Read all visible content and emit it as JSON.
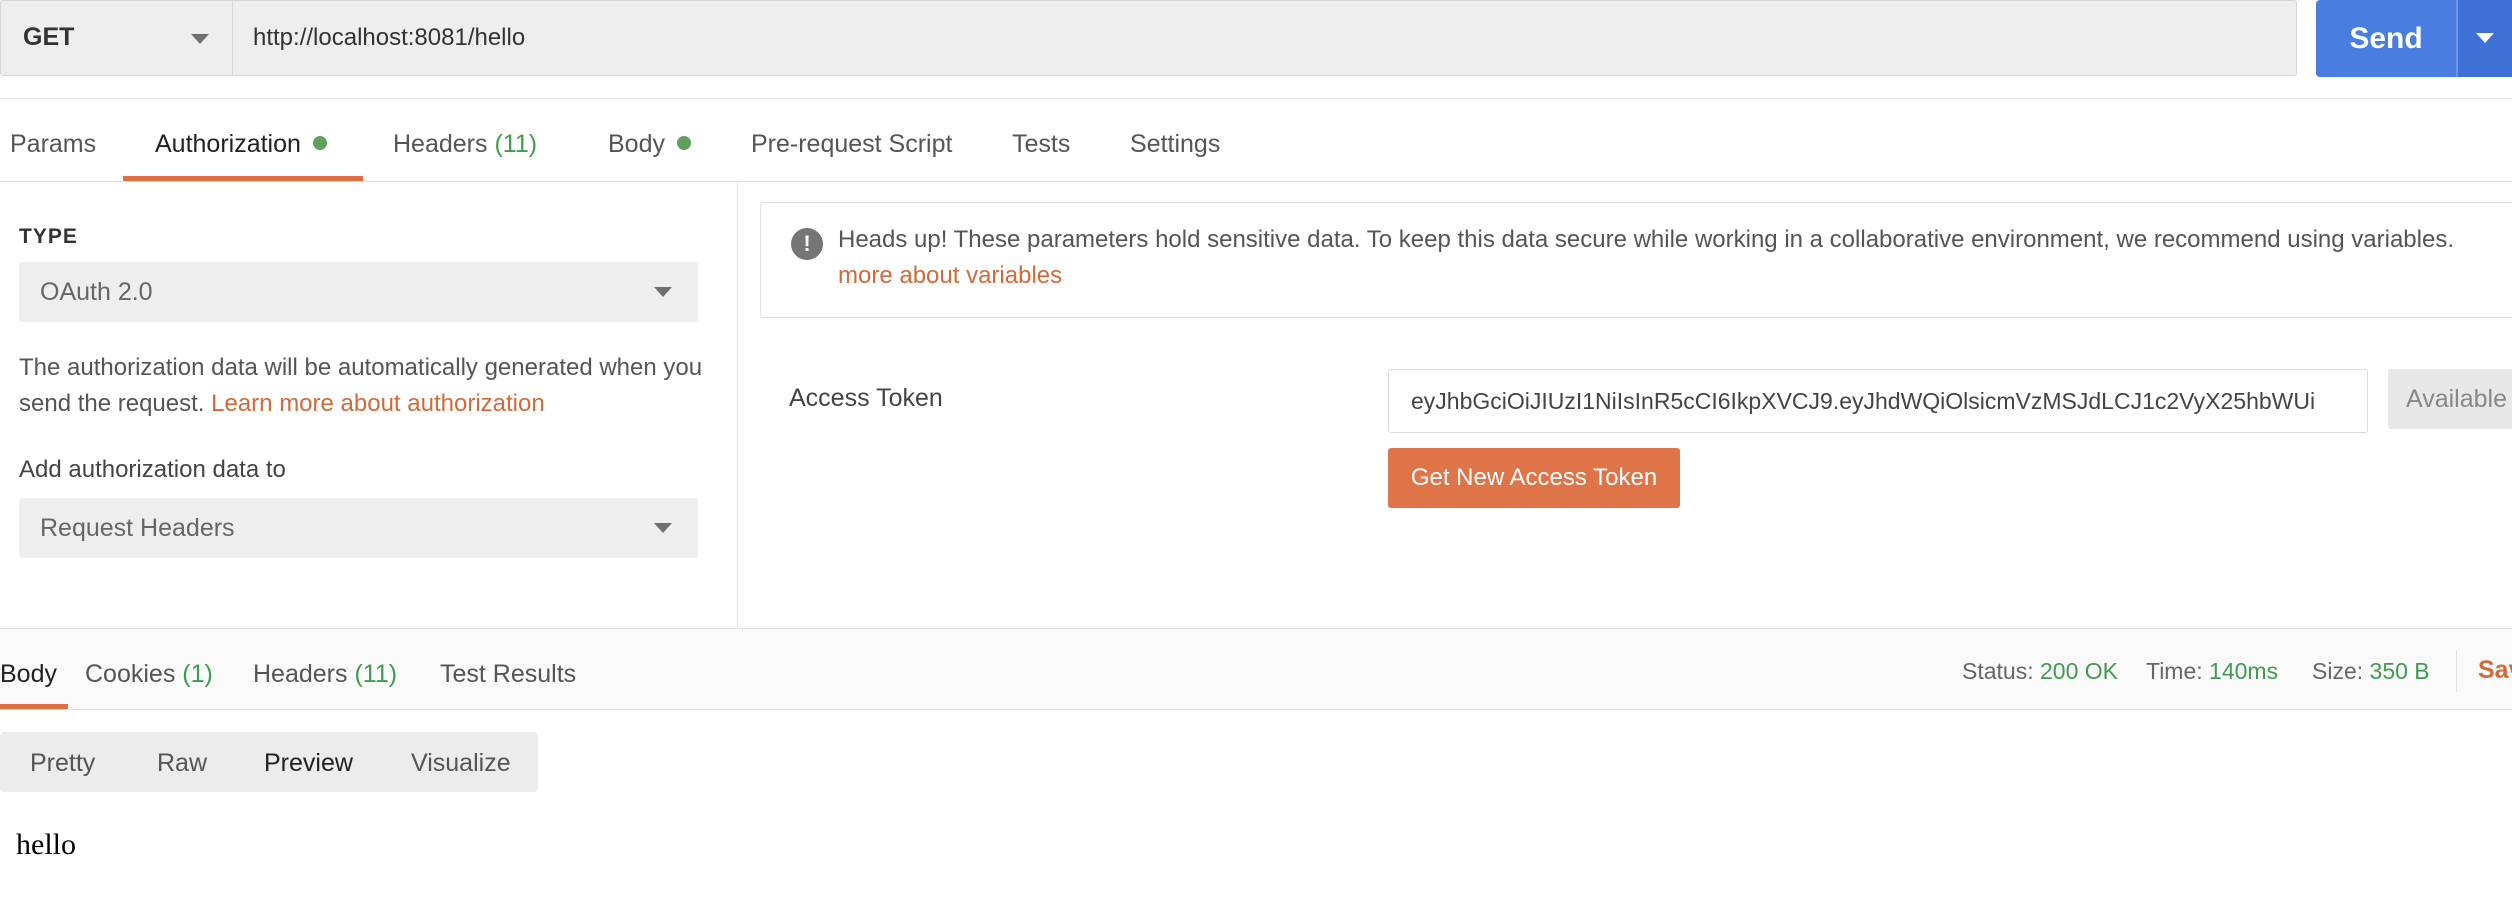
{
  "request": {
    "method": "GET",
    "url": "http://localhost:8081/hello",
    "send_label": "Send"
  },
  "request_tabs": [
    {
      "label": "Params"
    },
    {
      "label": "Authorization",
      "dot": true,
      "active": true
    },
    {
      "label": "Headers",
      "count": "(11)"
    },
    {
      "label": "Body",
      "dot": true
    },
    {
      "label": "Pre-request Script"
    },
    {
      "label": "Tests"
    },
    {
      "label": "Settings"
    }
  ],
  "auth": {
    "type_heading": "TYPE",
    "type_value": "OAuth 2.0",
    "description": "The authorization data will be automatically generated when you send the request.",
    "learn_more": "Learn more about authorization",
    "add_to_label": "Add authorization data to",
    "add_to_value": "Request Headers"
  },
  "heads_up": {
    "text": "Heads up! These parameters hold sensitive data. To keep this data secure while working in a collaborative environment, we recommend using variables.",
    "link": "more about variables"
  },
  "token": {
    "label": "Access Token",
    "value": "eyJhbGciOiJIUzI1NiIsInR5cCI6IkpXVCJ9.eyJhdWQiOlsicmVzMSJdLCJ1c2VyX25hbWUi",
    "available_label": "Available Tokens",
    "get_new_label": "Get New Access Token"
  },
  "response_tabs": [
    {
      "label": "Body",
      "active": true
    },
    {
      "label": "Cookies",
      "count": "(1)"
    },
    {
      "label": "Headers",
      "count": "(11)"
    },
    {
      "label": "Test Results"
    }
  ],
  "status": {
    "status_label": "Status:",
    "status_value": "200 OK",
    "time_label": "Time:",
    "time_value": "140ms",
    "size_label": "Size:",
    "size_value": "350 B",
    "save_label": "Save"
  },
  "view_tabs": [
    {
      "label": "Pretty"
    },
    {
      "label": "Raw"
    },
    {
      "label": "Preview",
      "active": true
    },
    {
      "label": "Visualize"
    }
  ],
  "body_content": "hello",
  "colors": {
    "accent": "#e06e45",
    "send_blue": "#4a7de0",
    "success_green": "#3f9c4f",
    "link_orange": "#d06a3a"
  }
}
